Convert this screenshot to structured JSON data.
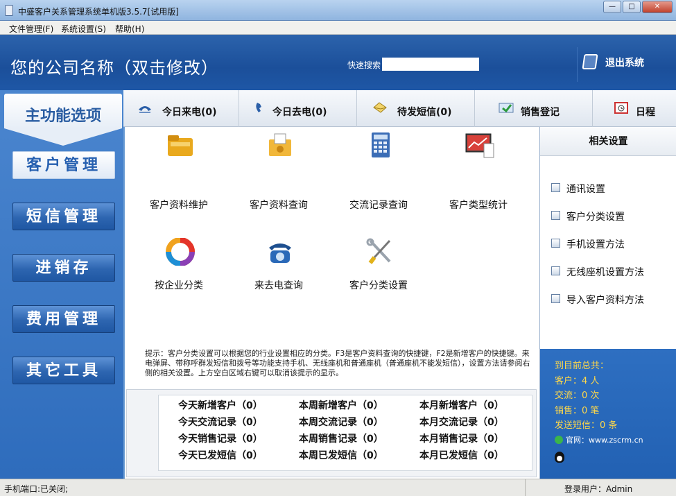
{
  "window": {
    "title": "中盛客户关系管理系统单机版3.5.7[试用版]",
    "buttons": {
      "minimize": "—",
      "maximize": "□",
      "close": "✕"
    }
  },
  "menu": [
    "文件管理(F)",
    "系统设置(S)",
    "帮助(H)"
  ],
  "header": {
    "company": "您的公司名称（双击修改）",
    "search_label": "快速搜索",
    "search_value": "",
    "logout": "退出系统"
  },
  "leftnav": {
    "title": "主功能选项",
    "items": [
      "客户管理",
      "短信管理",
      "进销存",
      "费用管理",
      "其它工具"
    ],
    "active": 0
  },
  "tabs": [
    {
      "label": "今日来电(0)",
      "icon": "incoming-call-icon"
    },
    {
      "label": "今日去电(0)",
      "icon": "outgoing-call-icon"
    },
    {
      "label": "待发短信(0)",
      "icon": "pending-sms-icon"
    },
    {
      "label": "销售登记",
      "icon": "sales-register-icon"
    },
    {
      "label": "日程",
      "icon": "schedule-icon"
    }
  ],
  "features": [
    {
      "label": "客户资料维护",
      "icon": "folder-icon"
    },
    {
      "label": "客户资料查询",
      "icon": "folder-search-icon"
    },
    {
      "label": "交流记录查询",
      "icon": "calculator-icon"
    },
    {
      "label": "客户类型统计",
      "icon": "chart-icon"
    },
    {
      "label": "按企业分类",
      "icon": "color-ring-icon"
    },
    {
      "label": "来去电查询",
      "icon": "telephone-icon"
    },
    {
      "label": "客户分类设置",
      "icon": "tools-icon"
    }
  ],
  "hint": "提示：客户分类设置可以根据您的行业设置相应的分类。F3是客户资料查询的快捷键，F2是新增客户的快捷键。来电弹屏、带称呼群发短信和拨号等功能支持手机、无线座机和普通座机（普通座机不能发短信），设置方法请参阅右侧的相关设置。上方空白区域右键可以取消该提示的显示。",
  "stats": [
    [
      "今天新增客户（0）",
      "本周新增客户（0）",
      "本月新增客户（0）"
    ],
    [
      "今天交流记录（0）",
      "本周交流记录（0）",
      "本月交流记录（0）"
    ],
    [
      "今天销售记录（0）",
      "本周销售记录（0）",
      "本月销售记录（0）"
    ],
    [
      "今天已发短信（0）",
      "本周已发短信（0）",
      "本月已发短信（0）"
    ]
  ],
  "settings": {
    "title": "相关设置",
    "items": [
      "通讯设置",
      "客户分类设置",
      "手机设置方法",
      "无线座机设置方法",
      "导入客户资料方法"
    ]
  },
  "summary": {
    "title": "到目前总共：",
    "lines": [
      "客户：4 人",
      "交流：0 次",
      "销售：0 笔",
      "发送短信：0 条"
    ],
    "website": "官网：www.zscrm.cn"
  },
  "status": {
    "left": "手机端口:已关闭;",
    "right": "登录用户：Admin"
  },
  "colors": {
    "header_blue": "#1b4f9a",
    "accent_yellow": "#ffd84a",
    "nav_blue": "#2d65b0"
  }
}
